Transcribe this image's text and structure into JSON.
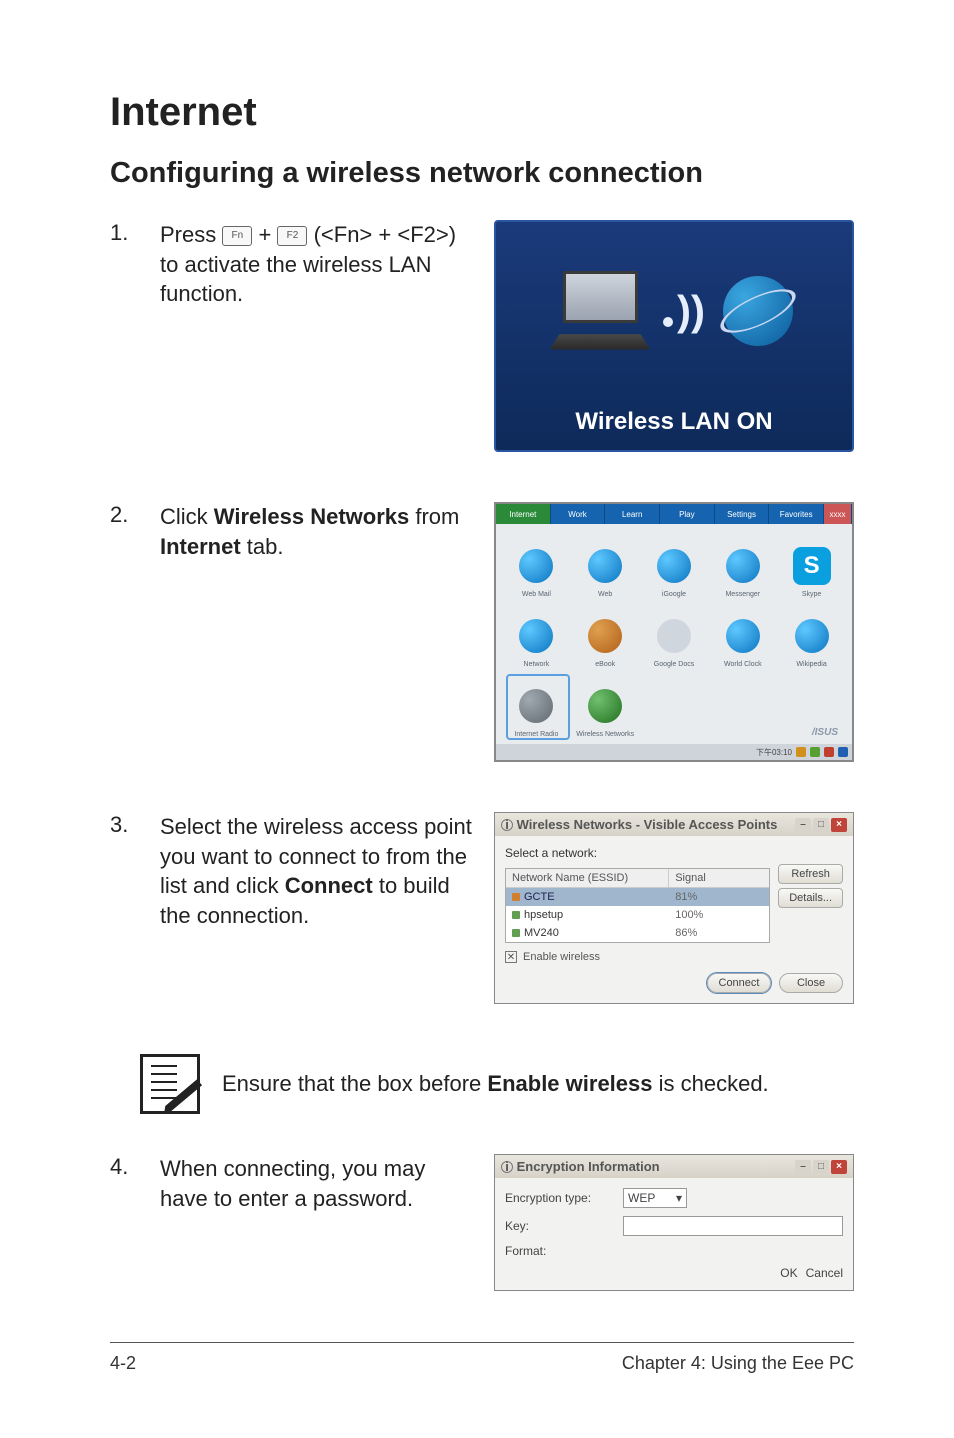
{
  "heading": "Internet",
  "subheading": "Configuring a wireless network connection",
  "steps": [
    {
      "num": "1.",
      "prefix": "Press ",
      "key1": "Fn",
      "plus": " + ",
      "key2": "F2",
      "suffix": " (<Fn> + <F2>) to activate the wireless LAN function."
    },
    {
      "num": "2.",
      "text_p1": "Click ",
      "bold1": "Wireless Networks",
      "text_p2": " from ",
      "bold2": "Internet",
      "text_p3": " tab."
    },
    {
      "num": "3.",
      "text_p1": "Select the wireless access point you want to connect to from the list and click ",
      "bold1": "Connect",
      "text_p2": " to build the connection."
    },
    {
      "num": "4.",
      "text": "When connecting, you may have to enter a password."
    }
  ],
  "wlan_on_label": "Wireless LAN ON",
  "internet_tab": {
    "tabs": [
      "Internet",
      "Work",
      "Learn",
      "Play",
      "Settings",
      "Favorites"
    ],
    "tab_end": "xxxx",
    "icons_row1": [
      "Web Mail",
      "Web",
      "iGoogle",
      "Messenger",
      "Skype"
    ],
    "icons_row2": [
      "Network",
      "eBook",
      "Google Docs",
      "World Clock",
      "Wikipedia"
    ],
    "icons_row3_a": "Internet Radio",
    "icons_row3_b": "Wireless Networks",
    "brand": "/ISUS",
    "status_time": "下午03:10"
  },
  "wnet_dialog": {
    "title": "Wireless Networks - Visible Access Points",
    "select_label": "Select a network:",
    "col1": "Network Name (ESSID)",
    "col2": "Signal",
    "items": [
      {
        "name": "GCTE",
        "signal": "81%",
        "sel": true
      },
      {
        "name": "hpsetup",
        "signal": "100%",
        "sel": false
      },
      {
        "name": "MV240",
        "signal": "86%",
        "sel": false
      }
    ],
    "refresh_btn": "Refresh",
    "details_btn": "Details...",
    "enable_label": "Enable wireless",
    "connect_btn": "Connect",
    "close_btn": "Close"
  },
  "note_text_p1": "Ensure that the box before ",
  "note_bold": "Enable wireless",
  "note_text_p2": " is checked.",
  "enc_dialog": {
    "title": "Encryption Information",
    "type_label": "Encryption type:",
    "type_value": "WEP",
    "key_label": "Key:",
    "format_label": "Format:",
    "ok_btn": "OK",
    "cancel_btn": "Cancel"
  },
  "footer_left": "4-2",
  "footer_right": "Chapter 4: Using the Eee PC"
}
